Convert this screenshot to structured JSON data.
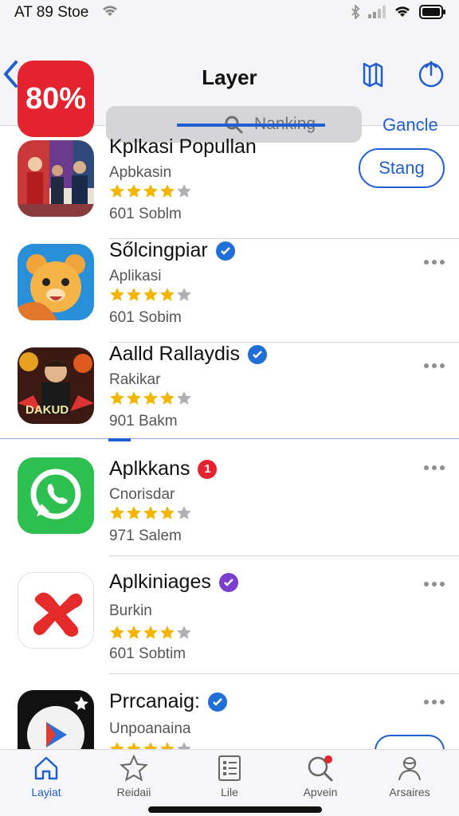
{
  "status": {
    "carrier": "AT 89 Stoe"
  },
  "header": {
    "badge": "80%",
    "title": "Layer",
    "search_placeholder": "Nanking",
    "cancel": "Gancle"
  },
  "apps": [
    {
      "name": "Kplkasi Popullan",
      "sub": "Apbkasin",
      "count": "601 Soblm",
      "action": "Stang",
      "verified": "",
      "rating": 4
    },
    {
      "name": "Sőlcingpiar",
      "sub": "Aplikasi",
      "count": "601 Sobim",
      "action": "",
      "verified": "blue",
      "rating": 4
    },
    {
      "name": "Aalld Rallaydis",
      "sub": "Rakikar",
      "count": "901 Bakm",
      "action": "",
      "verified": "blue",
      "rating": 4,
      "icon_text": "DAKUD"
    },
    {
      "name": "Aplkkans",
      "sub": "Cnorisdar",
      "count": "971 Salem",
      "action": "",
      "verified": "red",
      "badge_num": "1",
      "rating": 4
    },
    {
      "name": "Aplkiniages",
      "sub": "Burkin",
      "count": "601 Sobtim",
      "action": "",
      "verified": "purple",
      "rating": 4
    },
    {
      "name": "Prrcanaig:",
      "sub": "Unpoanaina",
      "count": "",
      "action": "",
      "verified": "blue",
      "rating": 4
    }
  ],
  "tabs": [
    {
      "label": "Layiat",
      "icon": "home-icon",
      "active": true
    },
    {
      "label": "Reidaii",
      "icon": "star-icon",
      "active": false
    },
    {
      "label": "Lile",
      "icon": "list-icon",
      "active": false
    },
    {
      "label": "Apvein",
      "icon": "search-icon",
      "active": false
    },
    {
      "label": "Arsaires",
      "icon": "profile-icon",
      "active": false
    }
  ],
  "colors": {
    "accent": "#1f5fcf",
    "badge_red": "#e5232f",
    "star": "#f4b400"
  }
}
